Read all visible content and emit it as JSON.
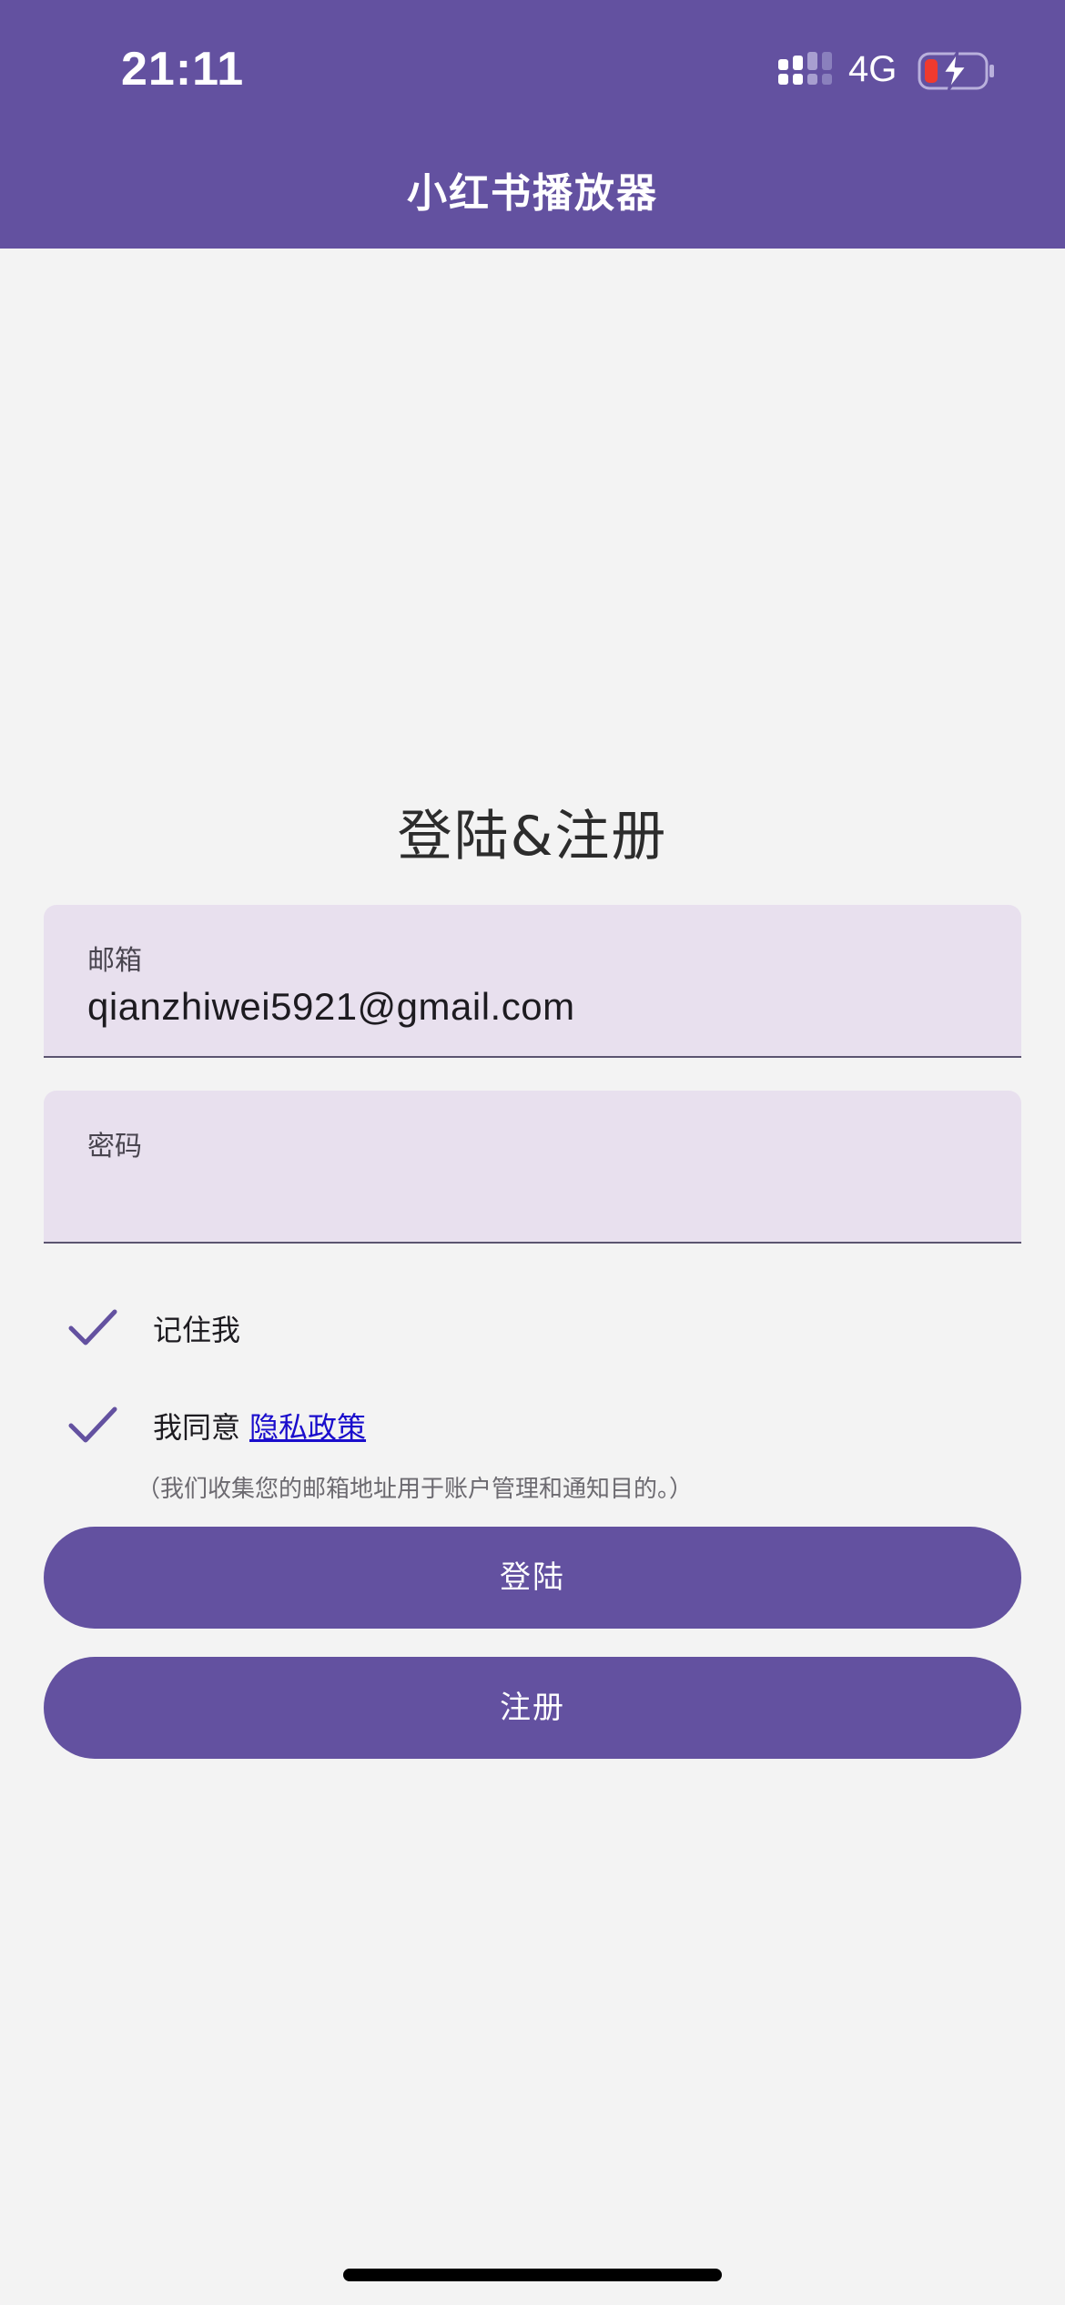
{
  "status_bar": {
    "time": "21:11",
    "network": "4G",
    "icons": [
      "signal-icon",
      "battery-charging-icon"
    ]
  },
  "header": {
    "title": "小红书播放器"
  },
  "main": {
    "title": "登陆&注册",
    "email": {
      "label": "邮箱",
      "value": "qianzhiwei5921@gmail.com"
    },
    "password": {
      "label": "密码",
      "value": ""
    },
    "remember_me": {
      "label": "记住我",
      "checked": true
    },
    "agree": {
      "label": "我同意",
      "link_text": "隐私政策",
      "checked": true
    },
    "privacy_note": "（我们收集您的邮箱地址用于账户管理和通知目的。）",
    "login_button": "登陆",
    "register_button": "注册"
  },
  "colors": {
    "primary": "#6351a0",
    "field_background": "#e8e0ee",
    "page_background": "#f3f3f3",
    "link": "#1a0dcc"
  }
}
